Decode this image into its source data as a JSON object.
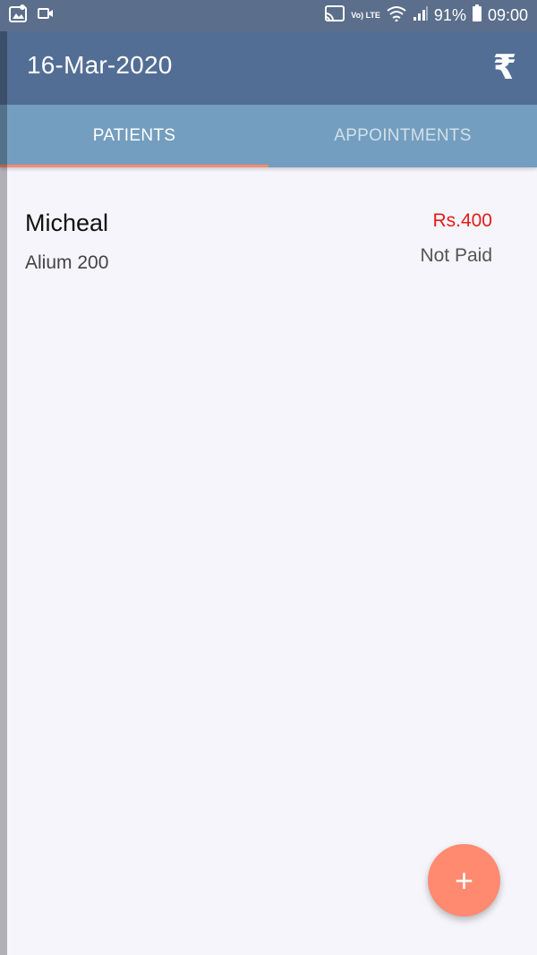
{
  "status_bar": {
    "battery_percent": "91%",
    "time": "09:00",
    "network_label": "Vo) LTE",
    "icons": [
      "gallery-icon",
      "video-icon",
      "cast-icon",
      "wifi-icon",
      "signal-icon",
      "battery-icon"
    ]
  },
  "appbar": {
    "title": "16-Mar-2020",
    "action_icon": "₹"
  },
  "tabs": [
    {
      "label": "PATIENTS",
      "active": true
    },
    {
      "label": "APPOINTMENTS",
      "active": false
    }
  ],
  "patients": [
    {
      "name": "Micheal",
      "medicine": "Alium 200",
      "amount": "Rs.400",
      "payment_status": "Not Paid"
    }
  ],
  "fab": {
    "icon": "+"
  },
  "colors": {
    "status_bar": "#5b6e8b",
    "appbar": "#536e95",
    "tabs": "#739ebf",
    "accent": "#ff8a70",
    "amount": "#e41b1b",
    "background": "#f5f5fb"
  }
}
